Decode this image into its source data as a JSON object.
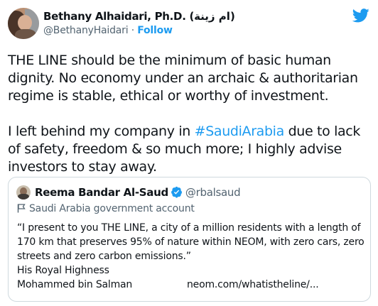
{
  "author": {
    "name": "Bethany Alhaidari, Ph.D. (ام زينة)",
    "handle": "@BethanyHaidari",
    "separator": " · ",
    "follow_label": "Follow"
  },
  "tweet": {
    "paragraph1": "THE LINE should be the minimum of basic human dignity. No economy under an archaic & authoritarian regime is stable, ethical or worthy of investment.",
    "paragraph2_before": "I left behind my company in ",
    "hashtag": "#SaudiArabia",
    "paragraph2_after": " due to lack of safety, freedom & so much more; I highly advise investors to stay away."
  },
  "quoted": {
    "name": "Reema Bandar Al-Saud",
    "handle": "@rbalsaud",
    "account_label": "Saudi Arabia government account",
    "text": "“I present to you THE LINE, a city of a million residents with a length of 170 km that preserves 95% of nature within NEOM, with zero cars, zero streets and zero carbon emissions.”",
    "line_signature": "His Royal Highness",
    "line_name": "Mohammed bin Salman",
    "link": "neom.com/whatistheline/..."
  },
  "icons": {
    "brand": "twitter-bird-icon",
    "verified": "verified-badge-icon",
    "flag": "flag-icon"
  },
  "colors": {
    "accent": "#1d9bf0",
    "muted": "#536471",
    "text": "#0f1419",
    "border": "#cfd9de"
  }
}
